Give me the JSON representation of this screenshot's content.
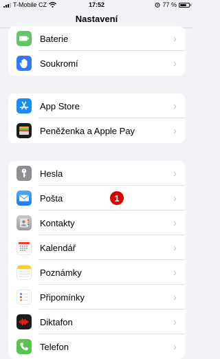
{
  "status_bar": {
    "carrier": "T-Mobile CZ",
    "time": "17:52",
    "battery_percent": "77 %",
    "battery_level": 0.77
  },
  "header": {
    "title": "Nastavení"
  },
  "groups": [
    {
      "items": [
        {
          "label": "Baterie",
          "icon": "battery-icon",
          "color": "#65c466"
        },
        {
          "label": "Soukromí",
          "icon": "hand-icon",
          "color": "#3478f6"
        }
      ]
    },
    {
      "items": [
        {
          "label": "App Store",
          "icon": "app-store-icon",
          "color": "#1a8cf7"
        },
        {
          "label": "Peněženka a Apple Pay",
          "icon": "wallet-icon",
          "color": "#1c1c1e"
        }
      ]
    },
    {
      "items": [
        {
          "label": "Hesla",
          "icon": "key-icon",
          "color": "#8e8e93"
        },
        {
          "label": "Pošta",
          "icon": "mail-icon",
          "color": "#2e8bf5"
        },
        {
          "label": "Kontakty",
          "icon": "contacts-icon",
          "color": "#a9a9ad"
        },
        {
          "label": "Kalendář",
          "icon": "calendar-icon",
          "color": "#ffffff"
        },
        {
          "label": "Poznámky",
          "icon": "notes-icon",
          "color": "#ffffff"
        },
        {
          "label": "Připomínky",
          "icon": "reminders-icon",
          "color": "#ffffff"
        },
        {
          "label": "Diktafon",
          "icon": "voice-memos-icon",
          "color": "#1c1c1e"
        },
        {
          "label": "Telefon",
          "icon": "phone-icon",
          "color": "#5ac451"
        }
      ]
    }
  ],
  "annotation": {
    "number": "1"
  }
}
